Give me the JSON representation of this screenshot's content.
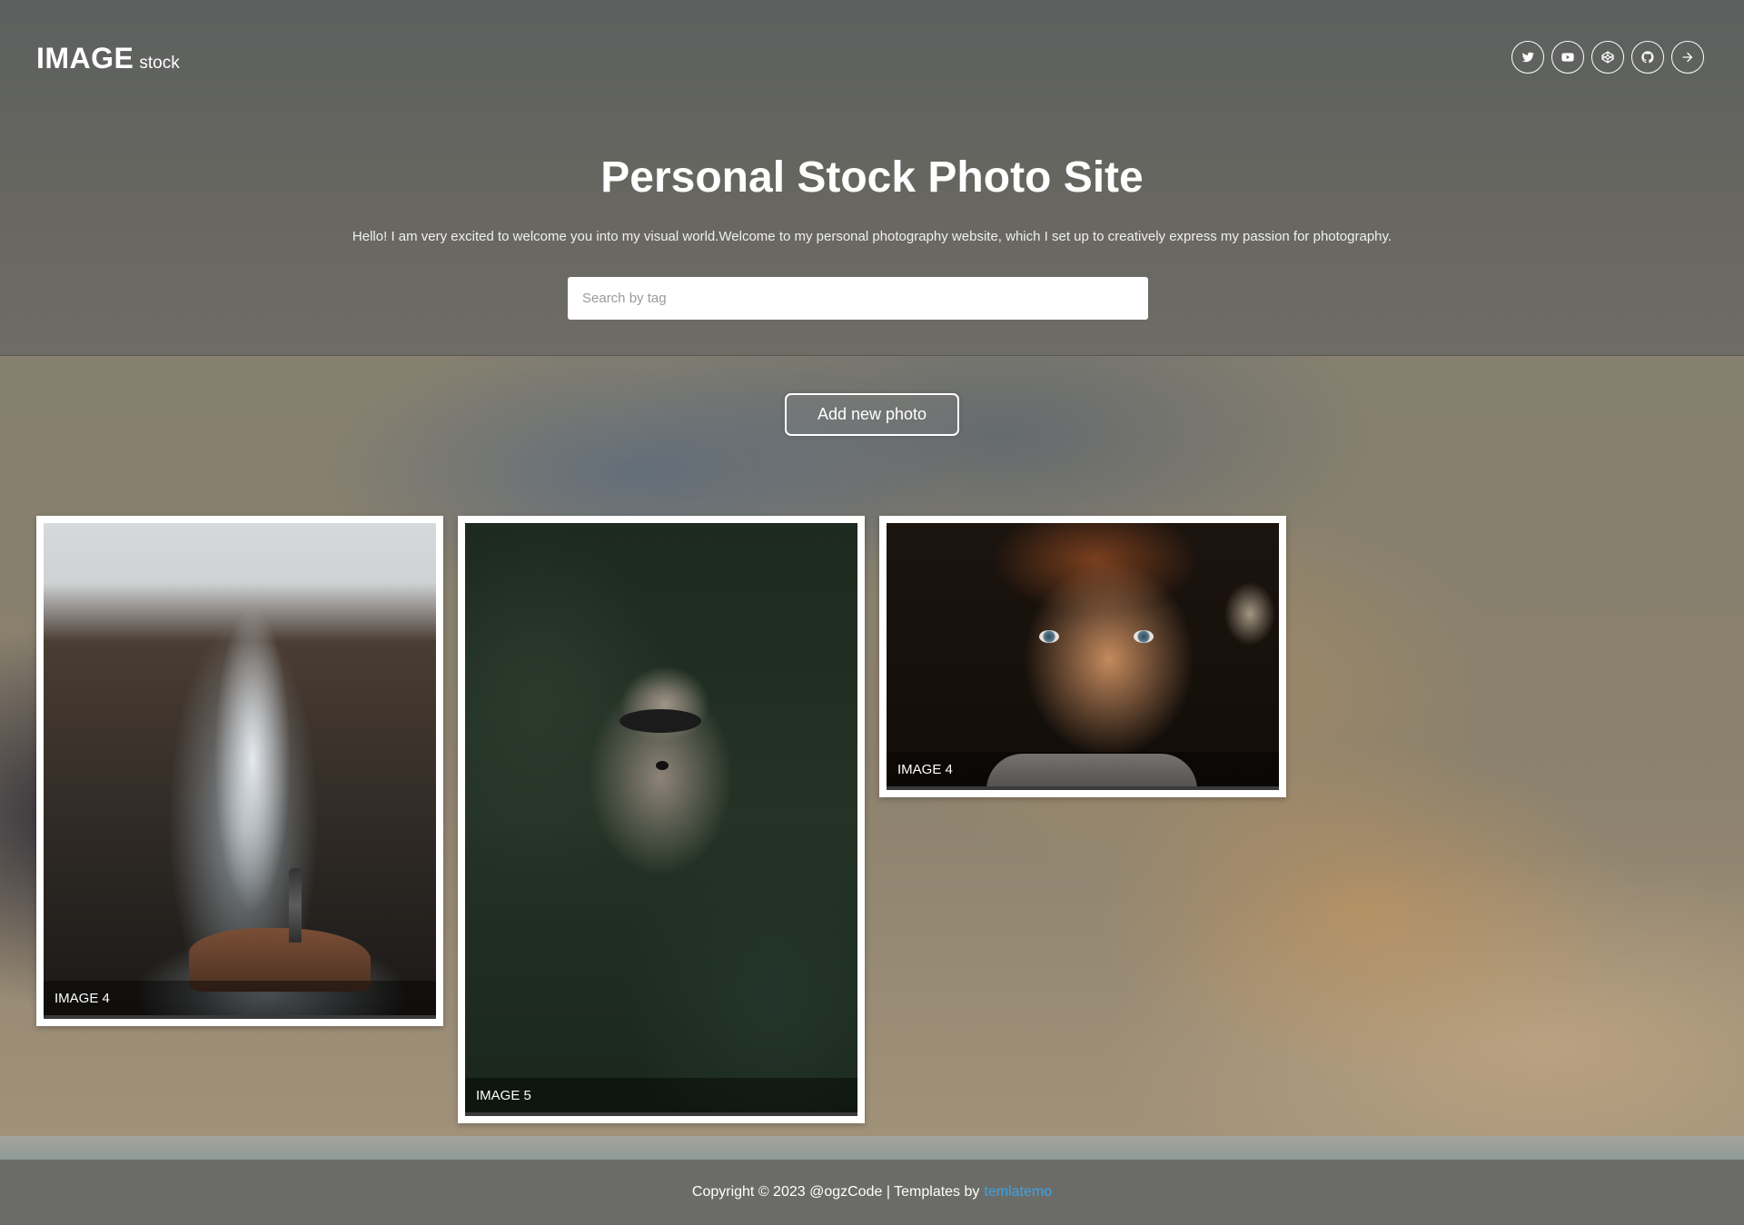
{
  "header": {
    "logo_main": "IMAGE",
    "logo_sub": "stock",
    "title": "Personal Stock Photo Site",
    "intro": "Hello! I am very excited to welcome you into my visual world.Welcome to my personal photography website, which I set up to creatively express my passion for photography.",
    "search_placeholder": "Search by tag",
    "socials": [
      "twitter-icon",
      "youtube-icon",
      "codepen-icon",
      "github-icon",
      "arrow-right-icon"
    ]
  },
  "actions": {
    "add_photo_label": "Add new photo"
  },
  "gallery": [
    {
      "caption": "IMAGE 4",
      "subject": "waterfall"
    },
    {
      "caption": "IMAGE 5",
      "subject": "raccoon"
    },
    {
      "caption": "IMAGE 4",
      "subject": "child portrait"
    }
  ],
  "footer": {
    "text": "Copyright © 2023 @ogzCode | Templates by",
    "link_label": "temlatemo",
    "link_color": "#3aa5e6"
  }
}
